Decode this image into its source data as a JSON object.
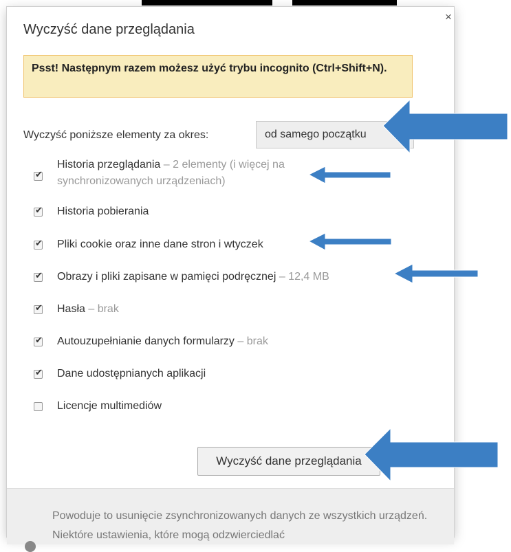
{
  "dialog": {
    "title": "Wyczyść dane przeglądania",
    "close_label": "×",
    "banner_text": "Psst! Następnym razem możesz użyć trybu incognito (Ctrl+Shift+N).",
    "period": {
      "label": "Wyczyść poniższe elementy za okres:",
      "selected": "od samego początku"
    },
    "options": [
      {
        "label": "Historia przeglądania",
        "detail": " – 2 elementy (i więcej na synchronizowanych urządzeniach)",
        "checked": true
      },
      {
        "label": "Historia pobierania",
        "detail": "",
        "checked": true
      },
      {
        "label": "Pliki cookie oraz inne dane stron i wtyczek",
        "detail": "",
        "checked": true
      },
      {
        "label": "Obrazy i pliki zapisane w pamięci podręcznej",
        "detail": " – 12,4 MB",
        "checked": true
      },
      {
        "label": "Hasła",
        "detail": " – brak",
        "checked": true
      },
      {
        "label": "Autouzupełnianie danych formularzy",
        "detail": " – brak",
        "checked": true
      },
      {
        "label": "Dane udostępnianych aplikacji",
        "detail": "",
        "checked": true
      },
      {
        "label": "Licencje multimediów",
        "detail": "",
        "checked": false
      }
    ],
    "clear_button": "Wyczyść dane przeglądania",
    "footer_text": "Powoduje to usunięcie zsynchronizowanych danych ze wszystkich urządzeń. Niektóre ustawienia, które mogą odzwierciedlać"
  },
  "colors": {
    "arrow": "#3c7fc4",
    "banner_bg": "#f9edbe",
    "banner_border": "#f0c36d"
  },
  "icons": [
    "close-icon",
    "checkbox-check-icon",
    "annotation-arrow-icon",
    "info-icon"
  ]
}
